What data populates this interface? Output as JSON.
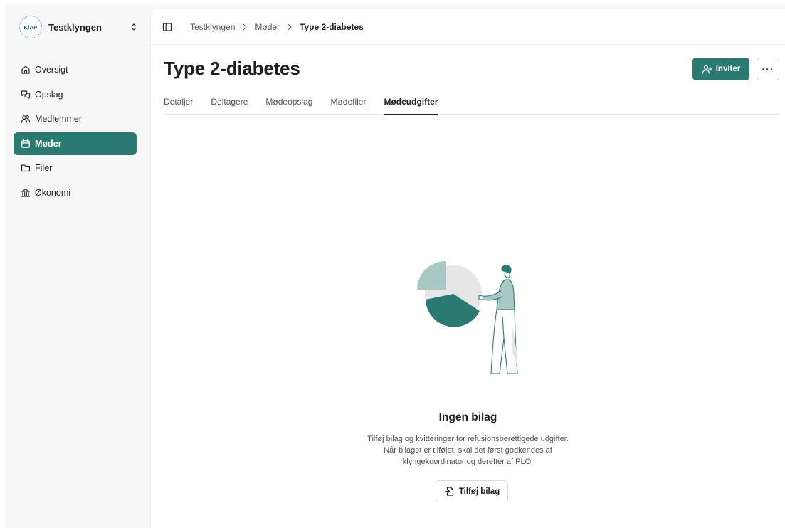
{
  "org": {
    "logo_text": "KiAP",
    "name": "Testklyngen"
  },
  "sidebar": {
    "items": [
      {
        "label": "Oversigt",
        "icon": "home-icon",
        "active": false
      },
      {
        "label": "Opslag",
        "icon": "chat-icon",
        "active": false
      },
      {
        "label": "Medlemmer",
        "icon": "users-icon",
        "active": false
      },
      {
        "label": "Møder",
        "icon": "calendar-icon",
        "active": true
      },
      {
        "label": "Filer",
        "icon": "folder-icon",
        "active": false
      },
      {
        "label": "Økonomi",
        "icon": "bank-icon",
        "active": false
      }
    ]
  },
  "breadcrumb": [
    "Testklyngen",
    "Møder",
    "Type 2-diabetes"
  ],
  "page": {
    "title": "Type 2-diabetes"
  },
  "actions": {
    "invite_label": "Inviter",
    "more_label": "···"
  },
  "tabs": [
    {
      "label": "Detaljer",
      "active": false
    },
    {
      "label": "Deltagere",
      "active": false
    },
    {
      "label": "Mødeopslag",
      "active": false
    },
    {
      "label": "Mødefiler",
      "active": false
    },
    {
      "label": "Mødeudgifter",
      "active": true
    }
  ],
  "empty_state": {
    "title": "Ingen bilag",
    "lines": [
      "Tilføj bilag og kvitteringer for refusionsberettigede udgifter.",
      "Når bilaget er tilføjet, skal det først godkendes af",
      "klyngekoordinator og derefter af PLO."
    ],
    "button_label": "Tilføj bilag"
  },
  "colors": {
    "accent": "#2b7a72",
    "accent_light": "#a9c8c3",
    "background": "#f7f7f8"
  }
}
